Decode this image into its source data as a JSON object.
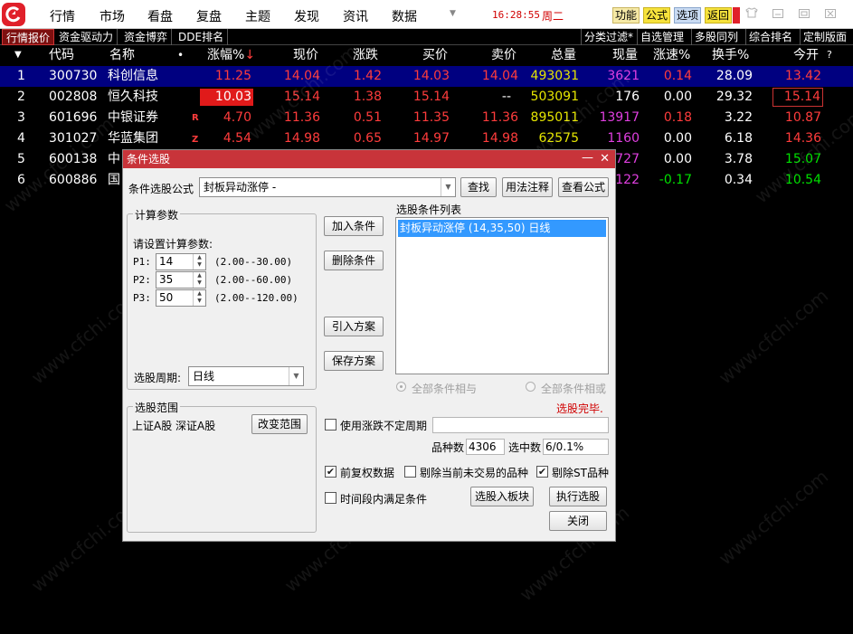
{
  "menubar": {
    "items": [
      "行情",
      "市场",
      "看盘",
      "复盘",
      "主题",
      "发现",
      "资讯",
      "数据"
    ],
    "time": "16:28:55",
    "weekday": "周二",
    "buttons": {
      "func": "功能",
      "formula": "公式",
      "options": "选项",
      "back": "返回"
    },
    "window_controls": [
      "shirt-icon",
      "minimize-icon",
      "restore-icon",
      "close-icon"
    ]
  },
  "tabs": {
    "left": [
      "行情报价",
      "资金驱动力",
      "资金博弈",
      "DDE排名"
    ],
    "right": [
      "分类过滤*",
      "自选管理",
      "多股同列",
      "综合排名",
      "定制版面"
    ]
  },
  "table": {
    "headers": {
      "num": "",
      "code": "代码",
      "name": "名称",
      "dot": "•",
      "pct": "涨幅%",
      "price": "现价",
      "change": "涨跌",
      "bid": "买价",
      "ask": "卖价",
      "volume": "总量",
      "cur_vol": "现量",
      "speed": "涨速%",
      "turnover": "换手%",
      "open": "今开",
      "help": "?"
    },
    "rows": [
      {
        "num": "1",
        "code": "300730",
        "name": "科创信息",
        "tag": "",
        "pct": "11.25",
        "price": "14.04",
        "change": "1.42",
        "bid": "14.03",
        "ask": "14.04",
        "volume": "493031",
        "cur_vol": "3621",
        "speed": "0.14",
        "turnover": "28.09",
        "open": "13.42"
      },
      {
        "num": "2",
        "code": "002808",
        "name": "恒久科技",
        "tag": "",
        "pct": "10.03",
        "price": "15.14",
        "change": "1.38",
        "bid": "15.14",
        "ask": "--",
        "volume": "503091",
        "cur_vol": "176",
        "speed": "0.00",
        "turnover": "29.32",
        "open": "15.14"
      },
      {
        "num": "3",
        "code": "601696",
        "name": "中银证券",
        "tag": "R",
        "pct": "4.70",
        "price": "11.36",
        "change": "0.51",
        "bid": "11.35",
        "ask": "11.36",
        "volume": "895011",
        "cur_vol": "13917",
        "speed": "0.18",
        "turnover": "3.22",
        "open": "10.87"
      },
      {
        "num": "4",
        "code": "301027",
        "name": "华蓝集团",
        "tag": "Z",
        "pct": "4.54",
        "price": "14.98",
        "change": "0.65",
        "bid": "14.97",
        "ask": "14.98",
        "volume": "62575",
        "cur_vol": "1160",
        "speed": "0.00",
        "turnover": "6.18",
        "open": "14.36"
      },
      {
        "num": "5",
        "code": "600138",
        "name": "中",
        "tag": "",
        "pct": "",
        "price": "",
        "change": "",
        "bid": "",
        "ask": "",
        "volume": "",
        "cur_vol": "727",
        "speed": "0.00",
        "turnover": "3.78",
        "open": "15.07"
      },
      {
        "num": "6",
        "code": "600886",
        "name": "国",
        "tag": "",
        "pct": "",
        "price": "",
        "change": "",
        "bid": "",
        "ask": "",
        "volume": "",
        "cur_vol": "122",
        "speed": "-0.17",
        "turnover": "0.34",
        "open": "10.54"
      }
    ]
  },
  "watermark": "www.cfchi.com",
  "dialog": {
    "title": "条件选股",
    "formula_label": "条件选股公式",
    "formula_value": "封板异动涨停 -",
    "btn_find": "查找",
    "btn_usage": "用法注释",
    "btn_view_formula": "查看公式",
    "calc_group": "计算参数",
    "calc_prompt": "请设置计算参数:",
    "params": [
      {
        "name": "P1:",
        "value": "14",
        "range": "(2.00--30.00)"
      },
      {
        "name": "P2:",
        "value": "35",
        "range": "(2.00--60.00)"
      },
      {
        "name": "P3:",
        "value": "50",
        "range": "(2.00--120.00)"
      }
    ],
    "period_label": "选股周期:",
    "period_value": "日线",
    "btn_add": "加入条件",
    "btn_delete": "删除条件",
    "btn_import": "引入方案",
    "btn_save": "保存方案",
    "list_label": "选股条件列表",
    "list_items": [
      "封板异动涨停 (14,35,50) 日线"
    ],
    "radio_and": "全部条件相与",
    "radio_or": "全部条件相或",
    "status": "选股完毕.",
    "range_group": "选股范围",
    "range_value": "上证A股 深证A股",
    "btn_change_range": "改变范围",
    "chk_uncertain_period": "使用涨跌不定周期",
    "count_label": "品种数",
    "count_value": "4306",
    "selected_label": "选中数",
    "selected_value": "6/0.1%",
    "chk_pre_adjust": "前复权数据",
    "chk_exclude_untraded": "剔除当前未交易的品种",
    "chk_exclude_st": "剔除ST品种",
    "chk_time_range": "时间段内满足条件",
    "btn_to_block": "选股入板块",
    "btn_execute": "执行选股",
    "btn_close": "关闭"
  }
}
